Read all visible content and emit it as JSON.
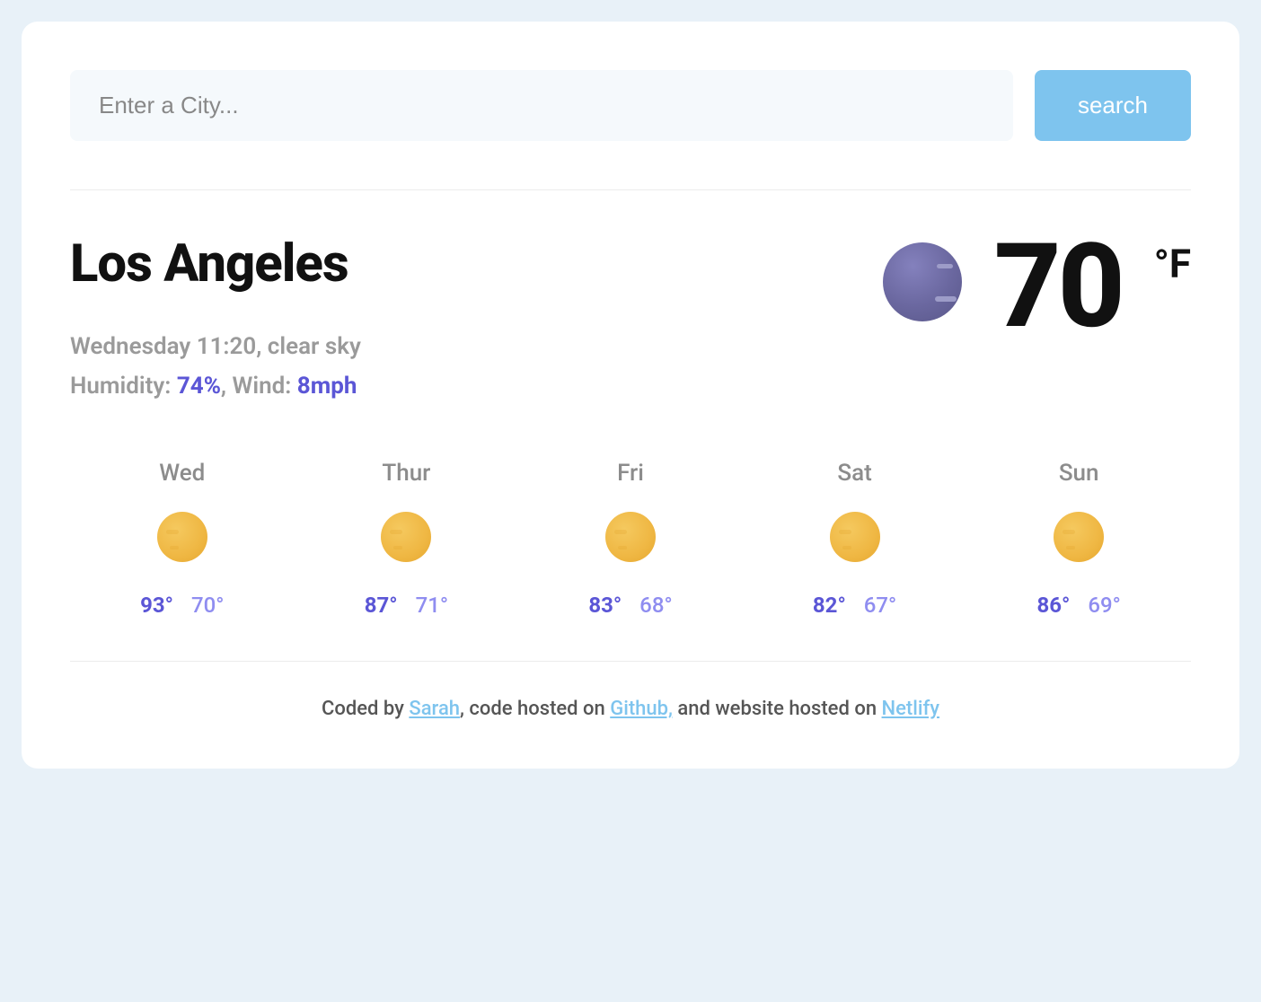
{
  "search": {
    "placeholder": "Enter a City...",
    "button_label": "search"
  },
  "current": {
    "city": "Los Angeles",
    "day_time_cond": "Wednesday 11:20, clear sky",
    "humidity_label": "Humidity:",
    "humidity_value": "74%",
    "wind_label": "Wind:",
    "wind_value": "8mph",
    "temp": "70",
    "unit": "°F",
    "icon": "moon"
  },
  "forecast": [
    {
      "day": "Wed",
      "hi": "93°",
      "lo": "70°",
      "icon": "sun"
    },
    {
      "day": "Thur",
      "hi": "87°",
      "lo": "71°",
      "icon": "sun"
    },
    {
      "day": "Fri",
      "hi": "83°",
      "lo": "68°",
      "icon": "sun"
    },
    {
      "day": "Sat",
      "hi": "82°",
      "lo": "67°",
      "icon": "sun"
    },
    {
      "day": "Sun",
      "hi": "86°",
      "lo": "69°",
      "icon": "sun"
    }
  ],
  "footer": {
    "prefix": "Coded by ",
    "author": "Sarah",
    "mid1": ", code hosted on ",
    "repo": "Github,",
    "mid2": " and website hosted on ",
    "host": "Netlify"
  }
}
